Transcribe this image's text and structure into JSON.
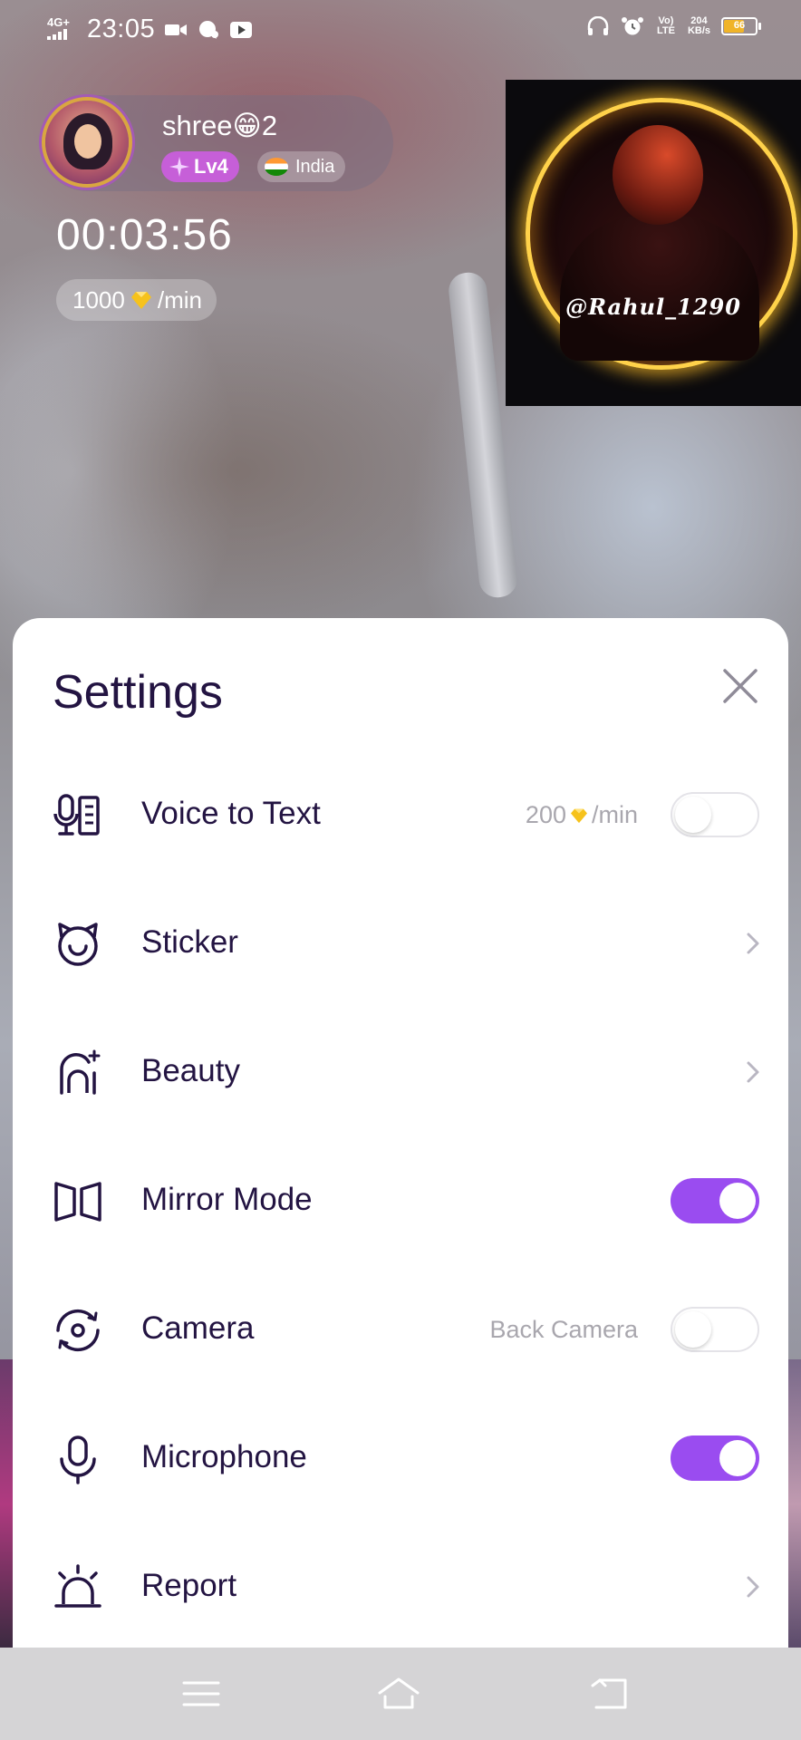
{
  "status_bar": {
    "network": "4G+",
    "time": "23:05",
    "volte": "Vo) LTE",
    "speed_value": "204",
    "speed_unit": "KB/s",
    "battery_level": "66",
    "battery_fraction": 0.66,
    "battery_color": "#f0b429"
  },
  "caller": {
    "name": "shree😁2",
    "level": "Lv4",
    "country": "India",
    "timer": "00:03:56",
    "rate_amount": "1000",
    "rate_unit": "/min"
  },
  "self_view": {
    "handle": "@Rahul_1290"
  },
  "settings": {
    "title": "Settings",
    "close_icon": "close-icon",
    "items": [
      {
        "label": "Voice to Text",
        "icon": "voice-to-text-icon",
        "hint_amount": "200",
        "hint_unit": "/min",
        "control": "toggle",
        "on": false
      },
      {
        "label": "Sticker",
        "icon": "sticker-icon",
        "control": "chevron"
      },
      {
        "label": "Beauty",
        "icon": "beauty-icon",
        "control": "chevron"
      },
      {
        "label": "Mirror Mode",
        "icon": "mirror-mode-icon",
        "control": "toggle",
        "on": true
      },
      {
        "label": "Camera",
        "icon": "camera-switch-icon",
        "hint": "Back Camera",
        "control": "toggle",
        "on": false
      },
      {
        "label": "Microphone",
        "icon": "microphone-icon",
        "control": "toggle",
        "on": true
      },
      {
        "label": "Report",
        "icon": "report-alarm-icon",
        "control": "chevron"
      }
    ]
  },
  "colors": {
    "accent": "#9a4cf0",
    "text_primary": "#231442",
    "text_secondary": "#a9a7ae",
    "level_badge": "#c65fd8"
  },
  "nav_bar": {
    "buttons": [
      "menu-icon",
      "home-icon",
      "back-icon"
    ]
  }
}
